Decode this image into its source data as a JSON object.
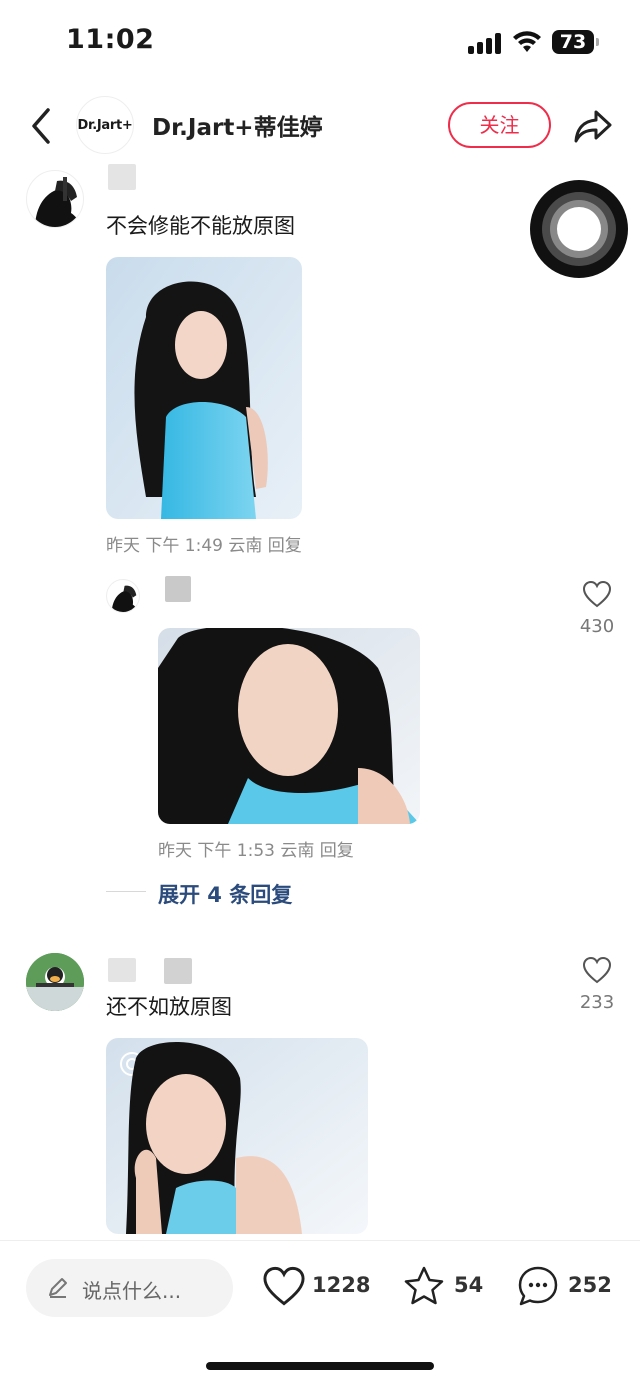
{
  "status_bar": {
    "time": "11:02",
    "battery": "73"
  },
  "header": {
    "brand_logo_text": "Dr.Jart+",
    "title": "Dr.Jart+蒂佳婷",
    "follow_label": "关注"
  },
  "comments": [
    {
      "text": "不会修能不能放原图",
      "meta": "昨天 下午 1:49 云南 回复"
    },
    {
      "meta": "昨天 下午 1:53 云南 回复",
      "likes": "430"
    },
    {
      "text": "还不如放原图",
      "likes": "233"
    }
  ],
  "expand_replies": "展开 4 条回复",
  "bottom_bar": {
    "input_placeholder": "说点什么...",
    "likes": "1228",
    "stars": "54",
    "comments": "252"
  }
}
